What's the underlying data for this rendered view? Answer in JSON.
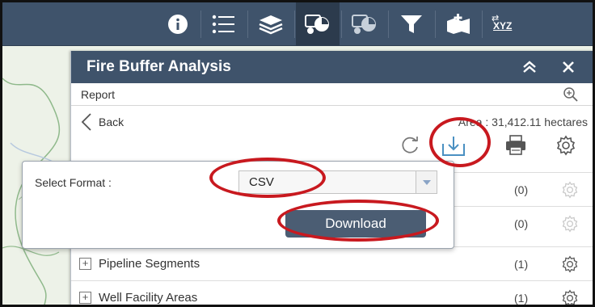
{
  "panel": {
    "title": "Fire Buffer Analysis",
    "report_label": "Report",
    "back_label": "Back",
    "area_text": "Area : 31,412.11 hectares"
  },
  "format_popup": {
    "label": "Select Format :",
    "selected_format": "CSV",
    "download_label": "Download"
  },
  "layers": [
    {
      "name": "",
      "count": "(0)"
    },
    {
      "name": "",
      "count": "(0)"
    },
    {
      "name": "Pipeline Segments",
      "count": "(1)"
    },
    {
      "name": "Well Facility Areas",
      "count": "(1)"
    }
  ],
  "toolbar": {
    "icons": [
      "info-icon",
      "list-icon",
      "layers-icon",
      "analysis-icon",
      "analysis-alt-icon",
      "filter-icon",
      "add-data-icon",
      "coordinate-icon"
    ],
    "coordinate_label": "XYZ"
  },
  "colors": {
    "header": "#3f536b",
    "button": "#4b5d73",
    "annotation": "#c8191f"
  }
}
